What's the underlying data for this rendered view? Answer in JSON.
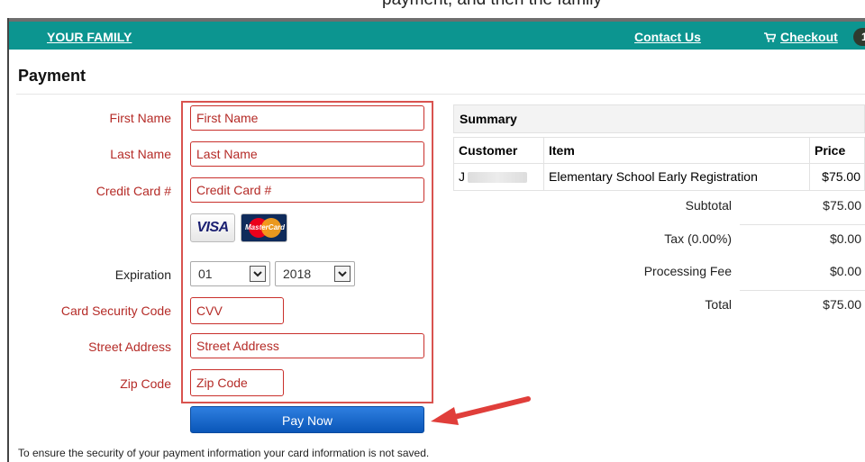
{
  "top_strip": {
    "cropped_text": "payment, and then the family"
  },
  "header": {
    "brand": "YOUR FAMILY",
    "contact": "Contact Us",
    "checkout": "Checkout",
    "cart_count": "1",
    "accent": "#0c9590"
  },
  "page": {
    "title": "Payment"
  },
  "form": {
    "first_name": {
      "label": "First Name",
      "placeholder": "First Name"
    },
    "last_name": {
      "label": "Last Name",
      "placeholder": "Last Name"
    },
    "card_number": {
      "label": "Credit Card #",
      "placeholder": "Credit Card #"
    },
    "card_logos": {
      "visa": "VISA",
      "mastercard": "MasterCard"
    },
    "expiration": {
      "label": "Expiration",
      "month": "01",
      "year": "2018"
    },
    "cvv": {
      "label": "Card Security Code",
      "placeholder": "CVV"
    },
    "street": {
      "label": "Street Address",
      "placeholder": "Street Address"
    },
    "zip": {
      "label": "Zip Code",
      "placeholder": "Zip Code"
    },
    "pay_button": "Pay Now",
    "security_note": "To ensure the security of your payment information your card information is not saved.",
    "highlight_color": "#d9534f"
  },
  "summary": {
    "title": "Summary",
    "columns": [
      "Customer",
      "Item",
      "Price"
    ],
    "rows": [
      {
        "customer": "J",
        "item": "Elementary School Early Registration",
        "price": "$75.00"
      }
    ],
    "subtotal": {
      "label": "Subtotal",
      "value": "$75.00"
    },
    "tax": {
      "label": "Tax (0.00%)",
      "value": "$0.00"
    },
    "fee": {
      "label": "Processing Fee",
      "value": "$0.00"
    },
    "total": {
      "label": "Total",
      "value": "$75.00"
    }
  }
}
